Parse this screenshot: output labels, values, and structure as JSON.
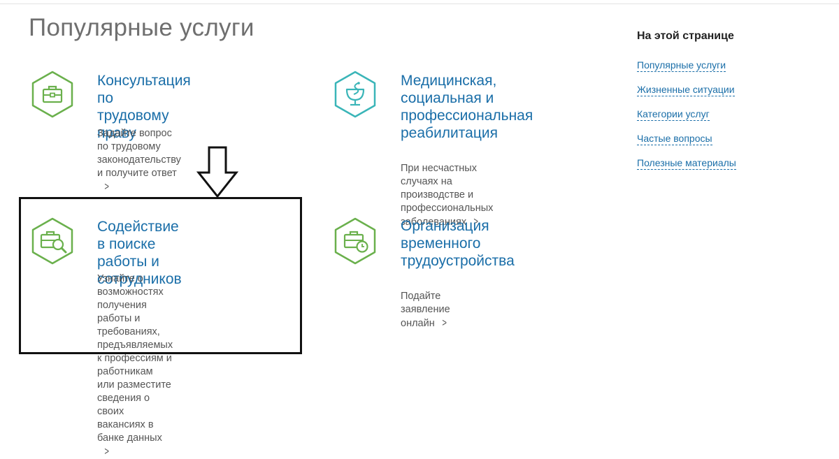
{
  "page_title": "Популярные услуги",
  "services": [
    {
      "title": "Консультация по\nтрудовому праву",
      "description": "Задайте вопрос по трудовому\nзаконодательству и получите ответ",
      "icon": "briefcase-icon",
      "icon_color": "#6ab04c"
    },
    {
      "title": "Медицинская,\nсоциальная и\nпрофессиональная\nреабилитация",
      "description": "При несчастных случаях на\nпроизводстве и профессиональных\nзаболеваниях",
      "icon": "medical-caduceus-icon",
      "icon_color": "#3ab5b8"
    },
    {
      "title": "Содействие в поиске\nработы и сотрудников",
      "description": "Узнайте о возможностях получения\nработы и требованиях,\nпредъявляемых к профессиям и\nработникам или разместите\nсведения о своих вакансиях в\nбанке данных",
      "icon": "briefcase-search-icon",
      "icon_color": "#6ab04c"
    },
    {
      "title": "Организация\nвременного\nтрудоустройства",
      "description": "Подайте заявление онлайн",
      "icon": "briefcase-clock-icon",
      "icon_color": "#6ab04c"
    }
  ],
  "sidebar": {
    "heading": "На этой странице",
    "links": [
      "Популярные услуги",
      "Жизненные ситуации",
      "Категории услуг",
      "Частые вопросы",
      "Полезные материалы"
    ]
  },
  "annotation": {
    "arrow": "down-arrow-icon",
    "highlight_color": "#111111"
  },
  "colors": {
    "link": "#1a6ea8",
    "text": "#555555",
    "green": "#6ab04c",
    "teal": "#3ab5b8"
  }
}
